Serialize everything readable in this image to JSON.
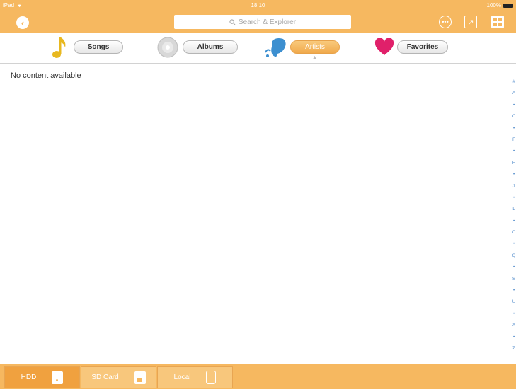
{
  "status_bar": {
    "device": "iPad",
    "wifi_icon": "wifi-icon",
    "time": "18:10",
    "battery": "100%"
  },
  "toolbar": {
    "search_placeholder": "Search & Explorer",
    "back_icon": "back-arrow-icon",
    "more_icon": "more-icon",
    "share_icon": "share-icon",
    "grid_icon": "grid-view-icon"
  },
  "tabs": [
    {
      "label": "Songs",
      "icon": "music-note-icon",
      "active": false
    },
    {
      "label": "Albums",
      "icon": "disc-icon",
      "active": false
    },
    {
      "label": "Artists",
      "icon": "artist-icon",
      "active": true
    },
    {
      "label": "Favorites",
      "icon": "heart-icon",
      "active": false
    }
  ],
  "content": {
    "empty_message": "No content available"
  },
  "index_letters": [
    "#",
    "A",
    "•",
    "C",
    "•",
    "F",
    "•",
    "H",
    "•",
    "J",
    "•",
    "L",
    "•",
    "O",
    "•",
    "Q",
    "•",
    "S",
    "•",
    "U",
    "•",
    "X",
    "•",
    "Z"
  ],
  "storage_tabs": [
    {
      "label": "HDD",
      "icon": "hdd-icon",
      "selected": true
    },
    {
      "label": "SD Card",
      "icon": "sd-card-icon",
      "selected": false
    },
    {
      "label": "Local",
      "icon": "ipad-icon",
      "selected": false
    }
  ],
  "colors": {
    "accent": "#f6b860",
    "index_letters": "#4a87c9",
    "favorite_heart": "#e0206a",
    "songs_note": "#e8b820"
  }
}
